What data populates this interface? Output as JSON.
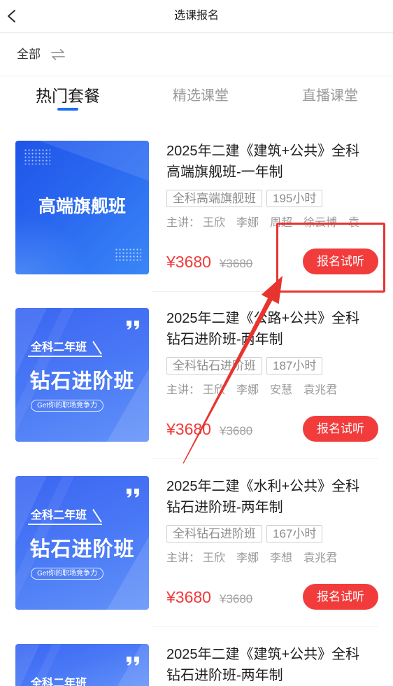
{
  "header": {
    "title": "选课报名",
    "back_icon": "chevron-left-icon"
  },
  "filter": {
    "label": "全部",
    "icon": "swap-icon"
  },
  "tabs": [
    {
      "label": "热门套餐",
      "active": true
    },
    {
      "label": "精选课堂",
      "active": false
    },
    {
      "label": "直播课堂",
      "active": false
    }
  ],
  "courses": [
    {
      "thumbnail": {
        "title": "高端旗舰班"
      },
      "title_line1": "2025年二建《建筑+公共》全科",
      "title_line2": "高端旗舰班-一年制",
      "tags": [
        "全科高端旗舰班",
        "195小时"
      ],
      "teachers_label": "主讲：",
      "teachers": [
        "王欣",
        "李娜",
        "周超",
        "徐云博",
        "袁"
      ],
      "price": "¥3680",
      "original_price": "¥3680",
      "button": "报名试听"
    },
    {
      "thumbnail": {
        "badge": "全科二年班",
        "title": "钻石进阶班",
        "slogan": "Get你的职场竞争力",
        "icon": "quote-icon"
      },
      "title_line1": "2025年二建《公路+公共》全科",
      "title_line2": "钻石进阶班-两年制",
      "tags": [
        "全科钻石进阶班",
        "187小时"
      ],
      "teachers_label": "主讲：",
      "teachers": [
        "王欣",
        "李娜",
        "安慧",
        "袁兆君"
      ],
      "price": "¥3680",
      "original_price": "¥3680",
      "button": "报名试听"
    },
    {
      "thumbnail": {
        "badge": "全科二年班",
        "title": "钻石进阶班",
        "slogan": "Get你的职场竞争力",
        "icon": "quote-icon"
      },
      "title_line1": "2025年二建《水利+公共》全科",
      "title_line2": "钻石进阶班-两年制",
      "tags": [
        "全科钻石进阶班",
        "167小时"
      ],
      "teachers_label": "主讲：",
      "teachers": [
        "王欣",
        "李娜",
        "李想",
        "袁兆君"
      ],
      "price": "¥3680",
      "original_price": "¥3680",
      "button": "报名试听"
    },
    {
      "thumbnail": {
        "badge": "全科二年班",
        "icon": "quote-icon"
      },
      "title_line1": "2025年二建《建筑+公共》全科",
      "title_line2": "钻石进阶班-两年制"
    }
  ],
  "colors": {
    "accent_blue": "#1d6ff0",
    "price_red": "#f23a3a",
    "button_red": "#f23c3c",
    "annotation_red": "#e8342f"
  }
}
